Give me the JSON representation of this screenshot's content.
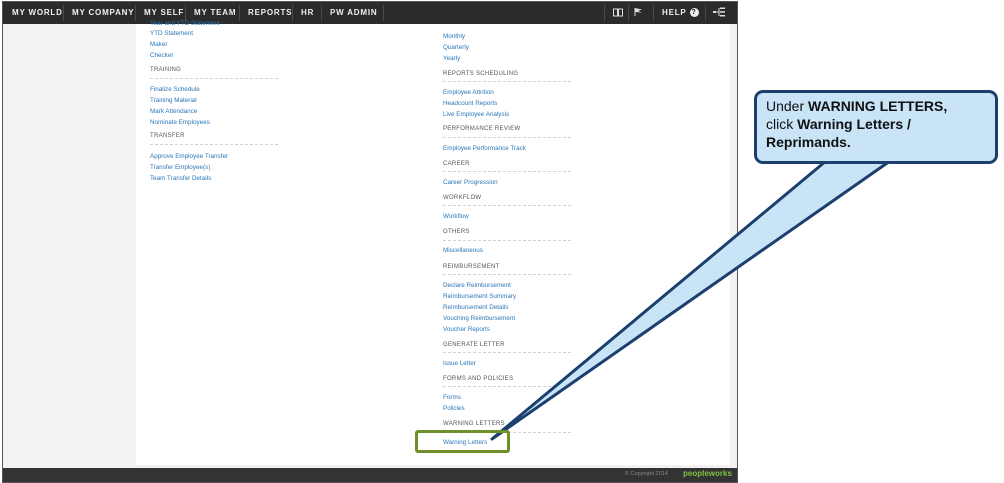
{
  "nav": {
    "items": [
      "MY WORLD",
      "MY COMPANY",
      "MY SELF",
      "MY TEAM",
      "REPORTS",
      "HR",
      "PW ADMIN"
    ],
    "help_label": "HELP",
    "help_badge": "?"
  },
  "left_column": {
    "cut_top_link": "Year and YTD Statement",
    "top_links": [
      "YTD Statement",
      "Maker",
      "Checker"
    ],
    "sections": [
      {
        "title": "TRAINING",
        "links": [
          "Finalize Schedule",
          "Training Material",
          "Mark Attendance",
          "Nominate Employees"
        ]
      },
      {
        "title": "TRANSFER",
        "links": [
          "Approve Employee Transfer",
          "Transfer Employee(s)",
          "Team Transfer Details"
        ]
      }
    ]
  },
  "right_column": {
    "top_links": [
      "Monthly",
      "Quarterly",
      "Yearly"
    ],
    "sections": [
      {
        "title": "REPORTS SCHEDULING",
        "links": [
          "Employee Attrition",
          "Headcount Reports",
          "Live Employee Analysis"
        ]
      },
      {
        "title": "PERFORMANCE REVIEW",
        "links": [
          "Employee Performance Track"
        ]
      },
      {
        "title": "CAREER",
        "links": [
          "Career Progression"
        ]
      },
      {
        "title": "WORKFLOW",
        "links": [
          "Workflow"
        ]
      },
      {
        "title": "OTHERS",
        "links": [
          "Miscellaneous"
        ]
      },
      {
        "title": "REIMBURSEMENT",
        "links": [
          "Declare Reimbursement",
          "Reimbursement Summary",
          "Reimbursement Details",
          "Vouching Reimbursement",
          "Voucher Reports"
        ]
      },
      {
        "title": "GENERATE LETTER",
        "links": [
          "Issue Letter"
        ]
      },
      {
        "title": "FORMS AND POLICIES",
        "links": [
          "Forms",
          "Policies"
        ]
      },
      {
        "title": "WARNING LETTERS",
        "links": [
          "Warning Letters"
        ]
      }
    ]
  },
  "footer": {
    "copyright": "© Copyright 2014",
    "brand": "peopleworks"
  },
  "callout": {
    "line1_prefix": "Under ",
    "line1_bold": "WARNING LETTERS,",
    "line2_prefix": "click ",
    "line2_bold": "Warning Letters /",
    "line3_bold": "Reprimands."
  },
  "colors": {
    "link": "#2a77b8",
    "nav_bg": "#2b2b2b",
    "highlight": "#6f8f2a",
    "callout_fill": "#c9e3f7",
    "callout_border": "#1d3f6e",
    "brand": "#7cc242"
  }
}
